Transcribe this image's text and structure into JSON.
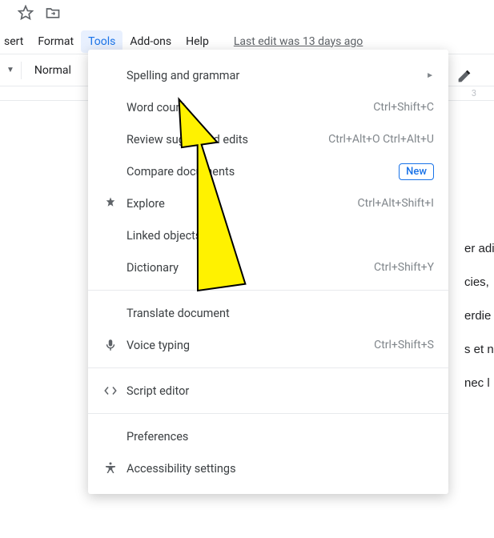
{
  "topIcons": {
    "star": "star-icon",
    "folder": "move-folder-icon"
  },
  "menubar": {
    "items": [
      {
        "label": "sert"
      },
      {
        "label": "Format"
      },
      {
        "label": "Tools",
        "active": true
      },
      {
        "label": "Add-ons"
      },
      {
        "label": "Help"
      }
    ],
    "lastEdit": "Last edit was 13 days ago"
  },
  "toolbar": {
    "styleLabel": "Normal"
  },
  "ruler": {
    "marks": [
      "3"
    ]
  },
  "dropdown": {
    "rows": [
      {
        "icon": "",
        "label": "Spelling and grammar",
        "right": "►",
        "rightType": "arrow"
      },
      {
        "icon": "",
        "label": "Word count",
        "right": "Ctrl+Shift+C",
        "rightType": "shortcut"
      },
      {
        "icon": "",
        "label": "Review suggested edits",
        "right": "Ctrl+Alt+O Ctrl+Alt+U",
        "rightType": "shortcut"
      },
      {
        "icon": "",
        "label": "Compare documents",
        "right": "New",
        "rightType": "badge"
      },
      {
        "icon": "explore",
        "label": "Explore",
        "right": "Ctrl+Alt+Shift+I",
        "rightType": "shortcut"
      },
      {
        "icon": "",
        "label": "Linked objects",
        "right": "",
        "rightType": ""
      },
      {
        "icon": "",
        "label": "Dictionary",
        "right": "Ctrl+Shift+Y",
        "rightType": "shortcut"
      },
      {
        "divider": true
      },
      {
        "icon": "",
        "label": "Translate document",
        "right": "",
        "rightType": ""
      },
      {
        "icon": "mic",
        "label": "Voice typing",
        "right": "Ctrl+Shift+S",
        "rightType": "shortcut"
      },
      {
        "divider": true
      },
      {
        "icon": "code",
        "label": "Script editor",
        "right": "",
        "rightType": ""
      },
      {
        "divider": true
      },
      {
        "icon": "",
        "label": "Preferences",
        "right": "",
        "rightType": ""
      },
      {
        "icon": "accessibility",
        "label": "Accessibility settings",
        "right": "",
        "rightType": ""
      }
    ]
  },
  "document": {
    "lines": [
      "er adi",
      "cies,",
      "erdie",
      "s et n",
      "nec l"
    ]
  }
}
